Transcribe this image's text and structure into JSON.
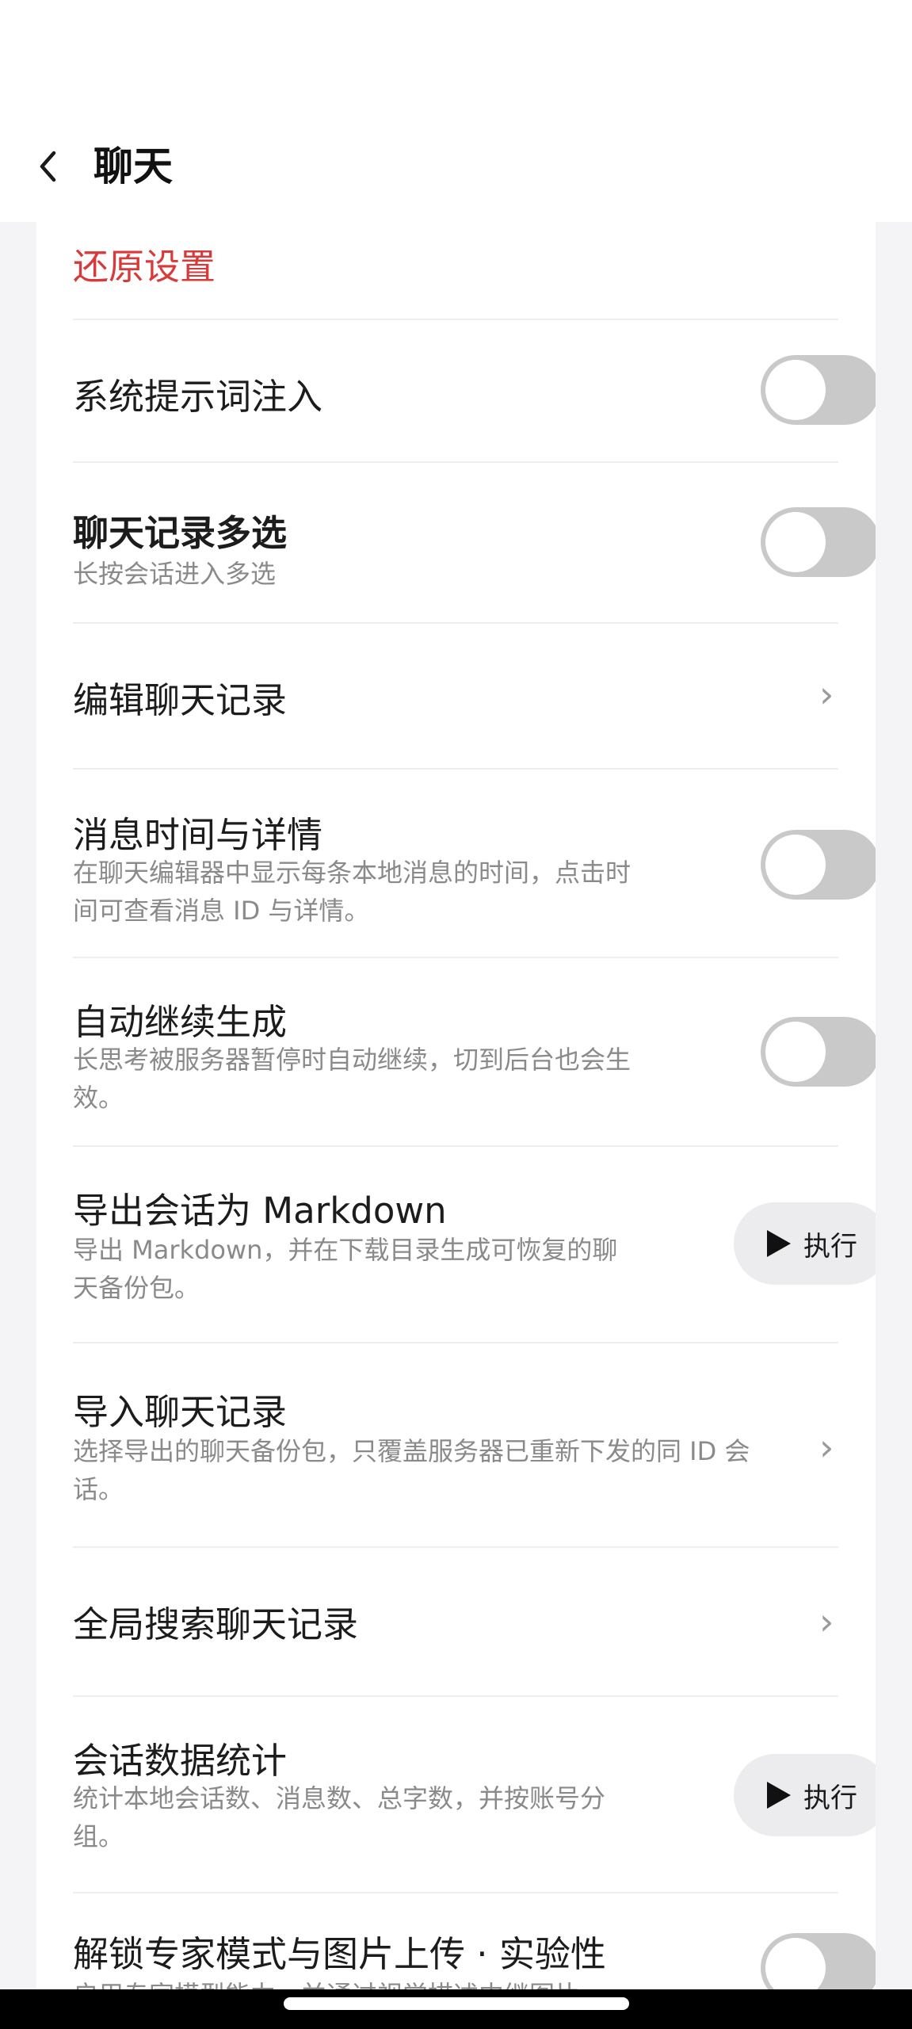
{
  "header": {
    "back_icon": "chevron-left-icon",
    "title": "聊天"
  },
  "reset_label": "还原设置",
  "rows": [
    {
      "title": "系统提示词注入",
      "control": "toggle",
      "on": false
    },
    {
      "title": "聊天记录多选",
      "subtitle": "长按会话进入多选",
      "control": "toggle",
      "on": false
    },
    {
      "title": "编辑聊天记录",
      "control": "chevron",
      "chevron": "›"
    },
    {
      "title": "消息时间与详情",
      "subtitle_lines": [
        "在聊天编辑器中显示每条本地消息的时间，点击时",
        "间可查看消息 ID 与详情。"
      ],
      "control": "toggle",
      "on": false
    },
    {
      "title": "自动继续生成",
      "subtitle_lines": [
        "长思考被服务器暂停时自动继续，切到后台也会生",
        "效。"
      ],
      "control": "toggle",
      "on": false
    },
    {
      "title": "导出会话为 Markdown",
      "subtitle_lines": [
        "导出 Markdown，并在下载目录生成可恢复的聊",
        "天备份包。"
      ],
      "control": "button",
      "button_label": "执行"
    },
    {
      "title": "导入聊天记录",
      "subtitle_lines": [
        "选择导出的聊天备份包，只覆盖服务器已重新下发的同 ID 会",
        "话。"
      ],
      "control": "chevron",
      "chevron": "›"
    },
    {
      "title": "全局搜索聊天记录",
      "control": "chevron",
      "chevron": "›"
    },
    {
      "title": "会话数据统计",
      "subtitle_lines": [
        "统计本地会话数、消息数、总字数，并按账号分",
        "组。"
      ],
      "control": "button",
      "button_label": "执行"
    },
    {
      "title": "解锁专家模式与图片上传 · 实验性",
      "subtitle_lines": [
        "启用专家模型能力，并通过视觉描述中继图片"
      ],
      "control": "toggle",
      "on": false
    }
  ],
  "colors": {
    "accent_red": "#d83a3a",
    "toggle_off": "#c9c9c9",
    "button_bg": "#ececee"
  }
}
